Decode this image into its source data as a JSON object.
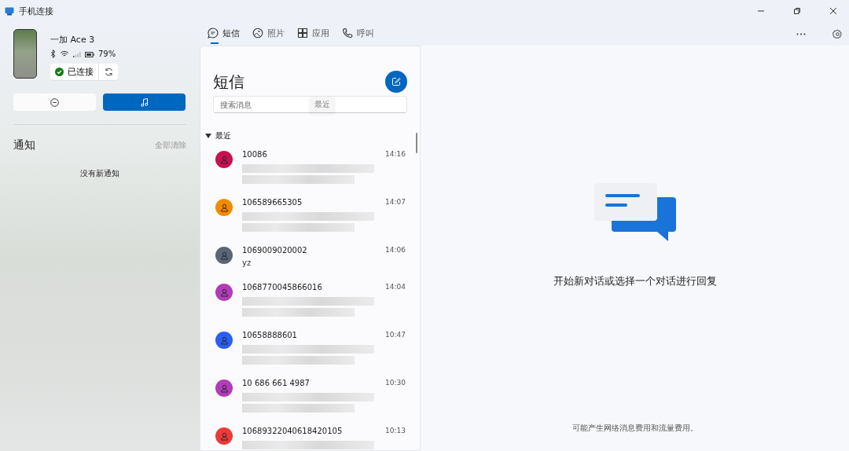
{
  "window": {
    "title": "手机连接"
  },
  "device": {
    "name": "一加 Ace 3",
    "battery": "79%",
    "status": "已连接"
  },
  "notifications": {
    "title": "通知",
    "clear": "全部清除",
    "empty": "没有新通知"
  },
  "tabs": [
    {
      "label": "短信",
      "selected": true
    },
    {
      "label": "照片",
      "selected": false
    },
    {
      "label": "应用",
      "selected": false
    },
    {
      "label": "呼叫",
      "selected": false
    }
  ],
  "messages": {
    "title": "短信",
    "search_placeholder": "搜索消息",
    "tooltip": "最近",
    "section": "最近",
    "expanded": true,
    "conversations": [
      {
        "name": "10086",
        "time": "14:16",
        "color": "#c8104f"
      },
      {
        "name": "106589665305",
        "time": "14:07",
        "color": "#f28a00"
      },
      {
        "name": "1069009020002",
        "time": "14:06",
        "color": "#5b6678",
        "preview": "yz"
      },
      {
        "name": "1068770045866016",
        "time": "14:04",
        "color": "#b23cb8"
      },
      {
        "name": "10658888601",
        "time": "10:47",
        "color": "#2a5ff0"
      },
      {
        "name": "10 686 661 4987",
        "time": "10:30",
        "color": "#b23cb8"
      },
      {
        "name": "10689322040618420105",
        "time": "10:13",
        "color": "#ea3b3b"
      }
    ]
  },
  "empty_state": {
    "text": "开始新对话或选择一个对话进行回复",
    "footer": "可能产生网络消息费用和流量费用。"
  }
}
